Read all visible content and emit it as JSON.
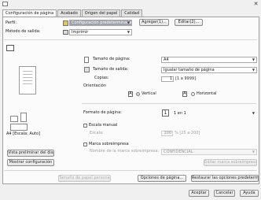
{
  "window": {
    "close_glyph": "✕"
  },
  "tabs": [
    {
      "label": "Configuración de página"
    },
    {
      "label": "Acabado"
    },
    {
      "label": "Origen del papel"
    },
    {
      "label": "Calidad"
    }
  ],
  "profile": {
    "label": "Perfil:",
    "value": "Configuración predeterminada",
    "add_button": "Agregar(1)...",
    "edit_button": "Editar(2)..."
  },
  "output_method": {
    "label": "Método de salida:",
    "value": "Imprimir"
  },
  "page_size": {
    "label": "Tamaño de página:",
    "value": "A4"
  },
  "output_size": {
    "label": "Tamaño de salida:",
    "value": "Igualar tamaño de página"
  },
  "copies": {
    "label": "Copias:",
    "value": "1",
    "range": "[1 a 9999]"
  },
  "orientation": {
    "label": "Orientación",
    "vertical_icon": "A",
    "vertical": "Vertical",
    "horizontal_icon": "A",
    "horizontal": "Horizontal",
    "selected": "Vertical"
  },
  "page_format": {
    "label": "Formato de página:",
    "icon_number": "1",
    "value": "1 en 1"
  },
  "manual_scaling": {
    "label": "Escala manual",
    "scale_label": "Escala:",
    "value": "100",
    "range": "% [25 a 200]"
  },
  "watermark": {
    "label": "Marca sobreimpresa",
    "name_label": "Nombre de la marca sobreimpresa:",
    "value": "CONFIDENCIAL",
    "edit_button": "Editar marca sobreimpresa..."
  },
  "left_panel": {
    "size_caption": "A4 [Escala: Auto]",
    "preview_button": "Vista preliminar del dispositivo",
    "show_settings_button": "Mostrar configuración"
  },
  "bottom_buttons": {
    "custom_paper": "Tamaño de papel personalizado...",
    "page_options": "Opciones de página...",
    "restore_defaults": "Restaurar las opciones predeterminadas"
  },
  "dialog_buttons": {
    "accept": "Aceptar",
    "cancel": "Cancelar",
    "help": "Ayuda"
  }
}
